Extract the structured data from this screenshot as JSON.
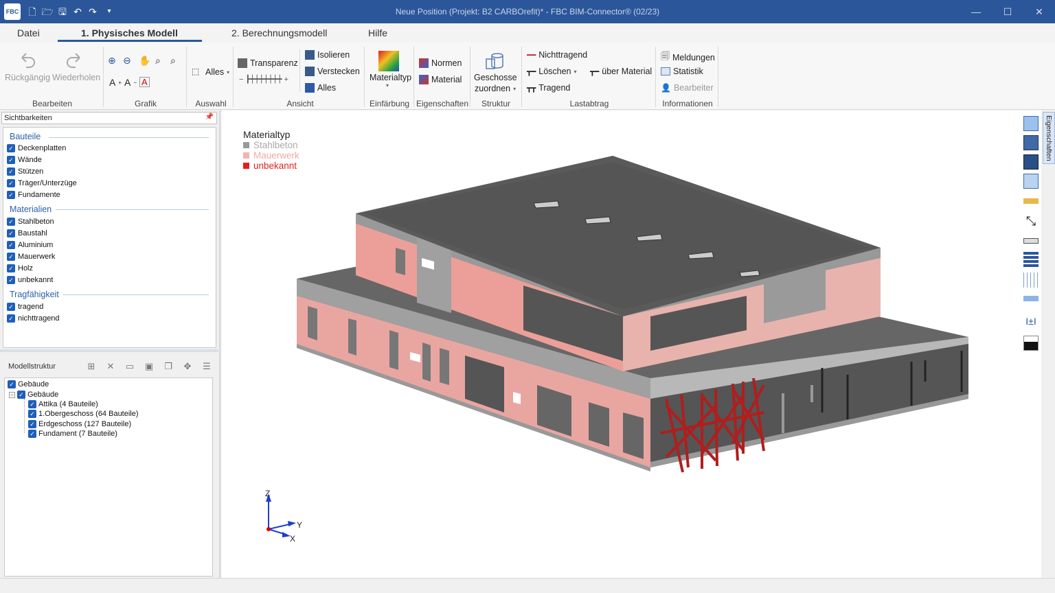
{
  "titlebar": {
    "logo": "FBC",
    "title": "Neue Position (Projekt: B2 CARBOrefit)*  -  FBC BIM-Connector® (02/23)"
  },
  "tabs": [
    {
      "label": "Datei"
    },
    {
      "label": "1. Physisches Modell",
      "active": true
    },
    {
      "label": "2. Berechnungsmodell"
    },
    {
      "label": "Hilfe"
    }
  ],
  "ribbon": {
    "groups": {
      "bearbeiten": "Bearbeiten",
      "grafik": "Grafik",
      "auswahl": "Auswahl",
      "ansicht": "Ansicht",
      "einfaerbung": "Einfärbung",
      "eigenschaften": "Eigenschaften",
      "struktur": "Struktur",
      "lastabtrag": "Lastabtrag",
      "informationen": "Informationen"
    },
    "buttons": {
      "undo": "Rückgängig",
      "redo": "Wiederholen",
      "alles_select": "Alles",
      "transparenz": "Transparenz",
      "isolieren": "Isolieren",
      "verstecken": "Verstecken",
      "alles": "Alles",
      "materialtyp": "Materialtyp",
      "normen": "Normen",
      "material": "Material",
      "geschosse_1": "Geschosse",
      "geschosse_2": "zuordnen",
      "nichttragend": "Nichttragend",
      "loeschen": "Löschen",
      "ueber_material": "über Material",
      "tragend": "Tragend",
      "meldungen": "Meldungen",
      "statistik": "Statistik",
      "bearbeiter": "Bearbeiter"
    }
  },
  "sichtbarkeiten": {
    "header": "Sichtbarkeiten",
    "bauteile_title": "Bauteile",
    "bauteile": [
      "Deckenplatten",
      "Wände",
      "Stützen",
      "Träger/Unterzüge",
      "Fundamente"
    ],
    "materialien_title": "Materialien",
    "materialien": [
      "Stahlbeton",
      "Baustahl",
      "Aluminium",
      "Mauerwerk",
      "Holz",
      "unbekannt"
    ],
    "tragfaehigkeit_title": "Tragfähigkeit",
    "tragfaehigkeit": [
      "tragend",
      "nichttragend"
    ]
  },
  "modellstruktur": {
    "title": "Modellstruktur",
    "root": "Gebäude",
    "child": "Gebäude",
    "items": [
      "Attika (4 Bauteile)",
      "1.Obergeschoss (64 Bauteile)",
      "Erdgeschoss (127 Bauteile)",
      "Fundament (7 Bauteile)"
    ]
  },
  "legend": {
    "title": "Materialtyp",
    "items": [
      {
        "label": "Stahlbeton",
        "color": "#9a9a9a"
      },
      {
        "label": "Mauerwerk",
        "color": "#f4b3ae"
      },
      {
        "label": "unbekannt",
        "color": "#e02020"
      }
    ]
  },
  "axes": {
    "z": "Z",
    "y": "Y",
    "x": "X"
  },
  "side_tab": "Eigenschaften"
}
